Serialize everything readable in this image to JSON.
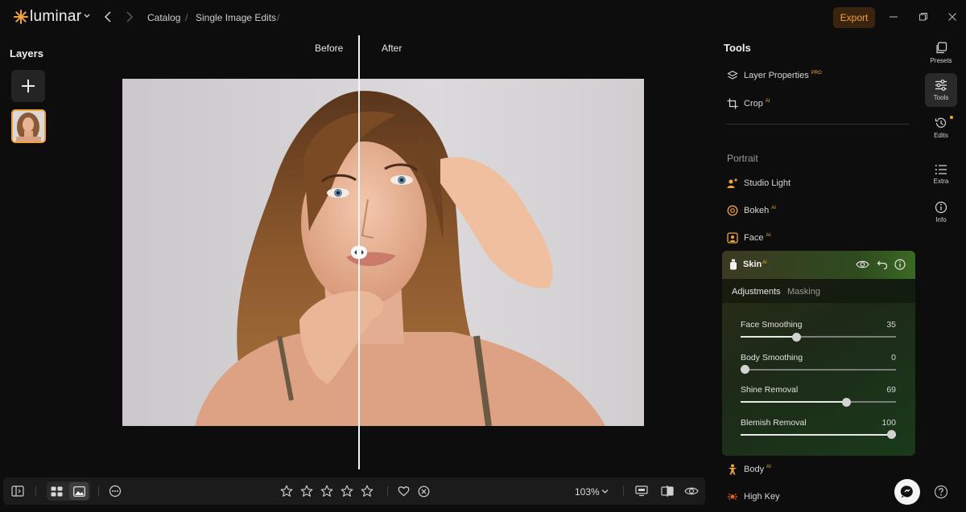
{
  "app": {
    "name": "luminar",
    "accent_color": "#f0a33b"
  },
  "header": {
    "breadcrumb": [
      "Catalog",
      "Single Image Edits"
    ],
    "breadcrumb_separator": "/",
    "export_label": "Export"
  },
  "layers": {
    "title": "Layers"
  },
  "canvas": {
    "before_label": "Before",
    "after_label": "After"
  },
  "bottombar": {
    "zoom": "103%",
    "rating_stars": 5
  },
  "tools": {
    "title": "Tools",
    "items": [
      {
        "label": "Layer Properties",
        "badge": "PRO",
        "icon": "layers-icon"
      },
      {
        "label": "Crop",
        "badge": "AI",
        "icon": "crop-icon"
      }
    ],
    "portrait": {
      "title": "Portrait",
      "items": [
        {
          "label": "Studio Light",
          "badge": "",
          "icon": "studio-light-icon"
        },
        {
          "label": "Bokeh",
          "badge": "AI",
          "icon": "bokeh-icon"
        },
        {
          "label": "Face",
          "badge": "AI",
          "icon": "face-icon"
        }
      ],
      "skin": {
        "label": "Skin",
        "badge": "AI",
        "tabs": [
          "Adjustments",
          "Masking"
        ],
        "active_tab": "Adjustments",
        "sliders": [
          {
            "label": "Face Smoothing",
            "value": "35",
            "fraction": 0.35
          },
          {
            "label": "Body Smoothing",
            "value": "0",
            "fraction": 0.0
          },
          {
            "label": "Shine Removal",
            "value": "69",
            "fraction": 0.69
          },
          {
            "label": "Blemish Removal",
            "value": "100",
            "fraction": 1.0
          }
        ]
      },
      "after_items": [
        {
          "label": "Body",
          "badge": "AI",
          "icon": "body-icon"
        },
        {
          "label": "High Key",
          "badge": "",
          "icon": "high-key-icon"
        }
      ]
    }
  },
  "rail": {
    "items": [
      {
        "label": "Presets",
        "icon": "presets-icon"
      },
      {
        "label": "Tools",
        "icon": "tools-icon"
      },
      {
        "label": "Edits",
        "icon": "history-icon"
      },
      {
        "label": "Extra",
        "icon": "list-icon"
      },
      {
        "label": "Info",
        "icon": "info-icon"
      }
    ]
  }
}
